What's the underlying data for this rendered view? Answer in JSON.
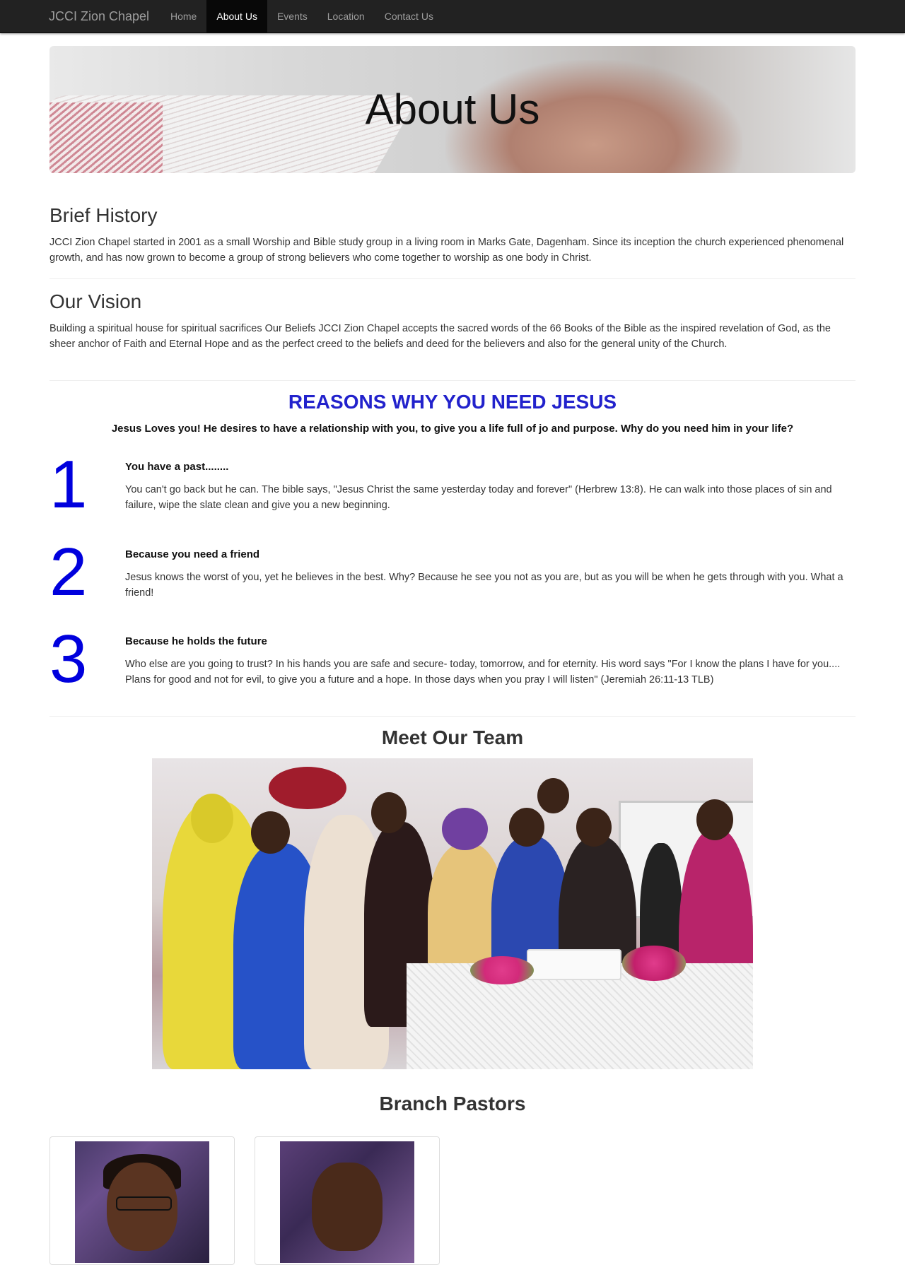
{
  "navbar": {
    "brand": "JCCI Zion Chapel",
    "links": [
      "Home",
      "About Us",
      "Events",
      "Location",
      "Contact Us"
    ],
    "active": "About Us"
  },
  "hero": {
    "title": "About Us"
  },
  "history": {
    "heading": "Brief History",
    "text": "JCCI Zion Chapel started in 2001 as a small Worship and Bible study group in a living room in Marks Gate, Dagenham. Since its inception the church experienced phenomenal growth, and has now grown to become a group of strong believers who come together to worship as one body in Christ."
  },
  "vision": {
    "heading": "Our Vision",
    "text": "Building a spiritual house for spiritual sacrifices Our Beliefs JCCI Zion Chapel accepts the sacred words of the 66 Books of the Bible as the inspired revelation of God, as the sheer anchor of Faith and Eternal Hope and as the perfect creed to the beliefs and deed for the believers and also for the general unity of the Church."
  },
  "reasons": {
    "title": "REASONS WHY YOU NEED JESUS",
    "subtitle": "Jesus Loves you! He desires to have a relationship with you, to give you a life full of jo and purpose. Why do you need him in your life?",
    "items": [
      {
        "number": "1",
        "title": "You have a past........",
        "body": "You can't go back but he can. The bible says, \"Jesus Christ the same yesterday today and forever\" (Herbrew 13:8). He can walk into those places of sin and failure, wipe the slate clean and give you a new beginning."
      },
      {
        "number": "2",
        "title": "Because you need a friend",
        "body": "Jesus knows the worst of you, yet he believes in the best. Why? Because he see you not as you are, but as you will be when he gets through with you. What a friend!"
      },
      {
        "number": "3",
        "title": "Because he holds the future",
        "body": "Who else are you going to trust? In his hands you are safe and secure- today, tomorrow, and for eternity. His word says \"For I know the plans I have for you.... Plans for good and not for evil, to give you a future and a hope. In those days when you pray I will listen\" (Jeremiah 26:11-13 TLB)"
      }
    ]
  },
  "team": {
    "heading": "Meet Our Team"
  },
  "pastors": {
    "heading": "Branch Pastors"
  },
  "colors": {
    "navbar_bg": "#222222",
    "reasons_blue": "#2222cc",
    "numeral_blue": "#0000dd"
  }
}
